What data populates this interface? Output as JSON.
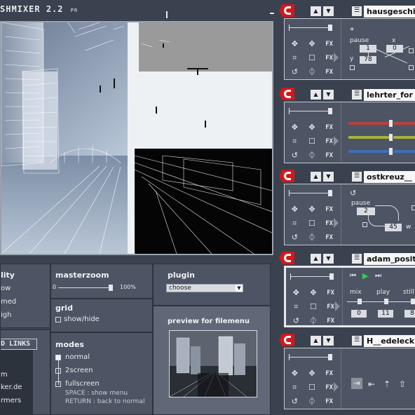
{
  "app": {
    "title": "SHMIXER",
    "version": "2.2",
    "version_suffix": "PR"
  },
  "panels": {
    "quality": {
      "title": "lity",
      "options": [
        "ow",
        "med",
        "igh"
      ]
    },
    "masterzoom": {
      "title": "masterzoom",
      "min_label": "0",
      "max_label": "100%",
      "value_percent": 100
    },
    "grid": {
      "title": "grid",
      "toggle_label": "show/hide"
    },
    "plugin": {
      "title": "plugin",
      "select_value": "choose"
    },
    "filemenu_preview": {
      "title": "preview for filemenu"
    },
    "links": {
      "title": "D LINKS",
      "items": [
        "m",
        "ker.de",
        "rmers"
      ]
    },
    "modes": {
      "title": "modes",
      "items": [
        "normal",
        "2screen",
        "fullscreen"
      ],
      "selected": "normal",
      "help_space": "SPACE : show menu",
      "help_return": "RETURN : back to normal"
    }
  },
  "channels": [
    {
      "name": "hausgeschi",
      "plugin": {
        "pause_label": "pause",
        "x_label": "x",
        "y_label": "y",
        "pause_value": "1",
        "x_value": "0",
        "y_value": "78"
      }
    },
    {
      "name": "lehrter_for",
      "bar_colors": [
        "#b8413f",
        "#a8b23c",
        "#3f6fb8"
      ]
    },
    {
      "name": "ostkreuz__",
      "plugin": {
        "pause_label": "pause",
        "pause_value": "2",
        "w_label": "w",
        "w_value": "45"
      }
    },
    {
      "name": "adam_posit",
      "plugin": {
        "labels": [
          "mix",
          "play",
          "still"
        ],
        "values": [
          "0",
          "11",
          "8"
        ]
      }
    },
    {
      "name": "H__edeleck"
    }
  ],
  "colors": {
    "accent_red": "#d4171c",
    "panel": "#4d5564",
    "background": "#3a4250"
  }
}
